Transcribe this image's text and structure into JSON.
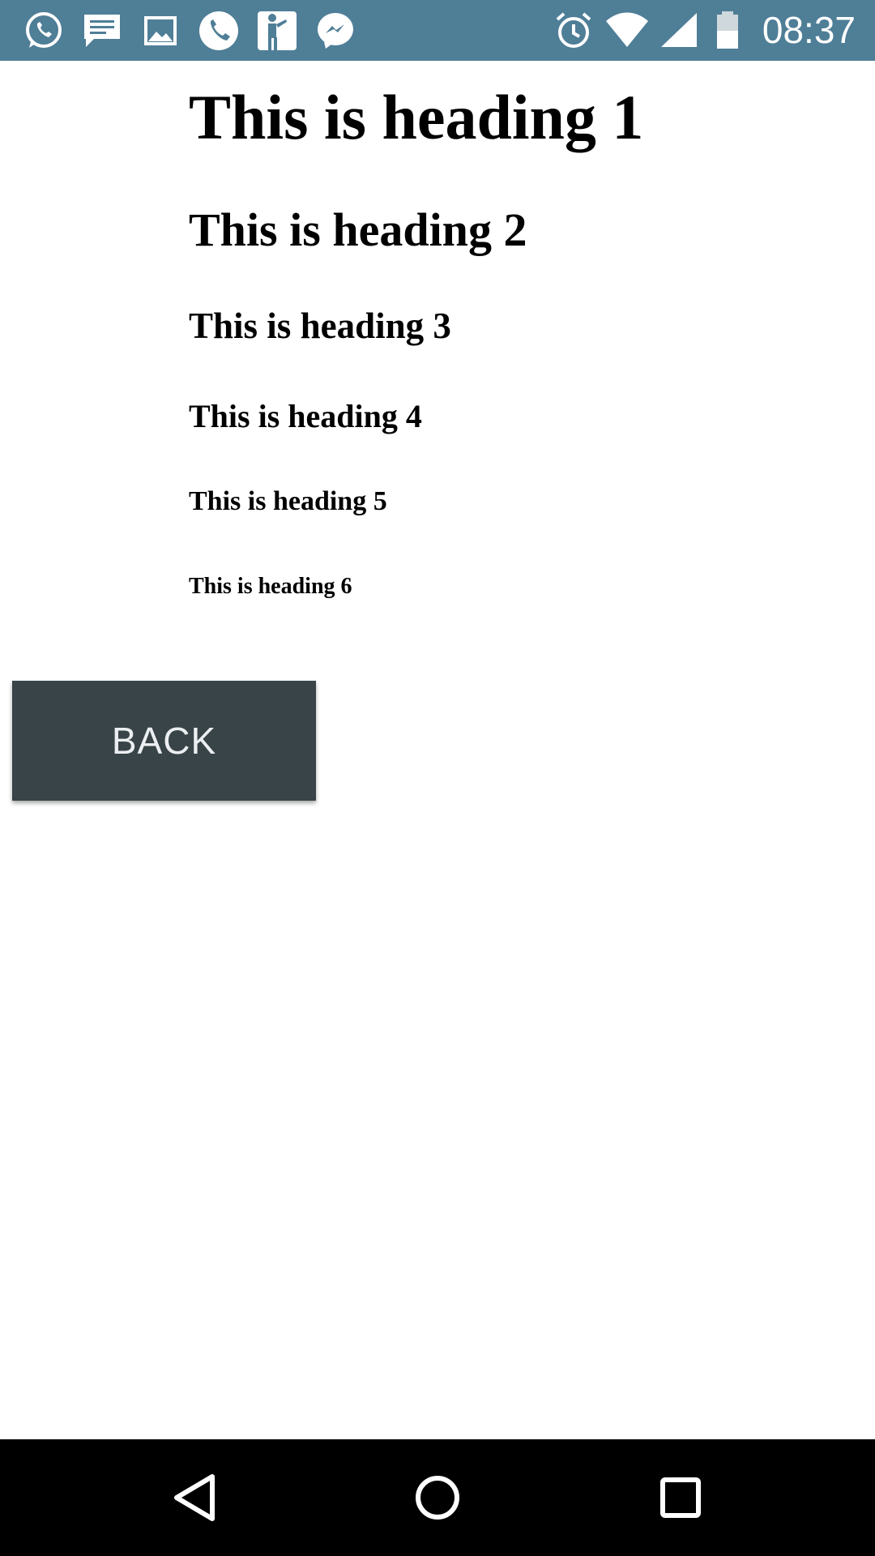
{
  "status_bar": {
    "time": "08:37",
    "left_icons": [
      "whatsapp-icon",
      "message-icon",
      "image-icon",
      "phone-icon",
      "person-icon",
      "messenger-icon"
    ],
    "right_icons": [
      "alarm-icon",
      "wifi-icon",
      "signal-icon",
      "battery-icon"
    ],
    "background_color": "#4f7e97"
  },
  "content": {
    "headings": {
      "h1": "This is heading 1",
      "h2": "This is heading 2",
      "h3": "This is heading 3",
      "h4": "This is heading 4",
      "h5": "This is heading 5",
      "h6": "This is heading 6"
    },
    "back_button_label": "BACK",
    "button_color": "#384448"
  },
  "nav_bar": {
    "buttons": [
      "back-triangle-icon",
      "home-circle-icon",
      "recents-square-icon"
    ]
  }
}
